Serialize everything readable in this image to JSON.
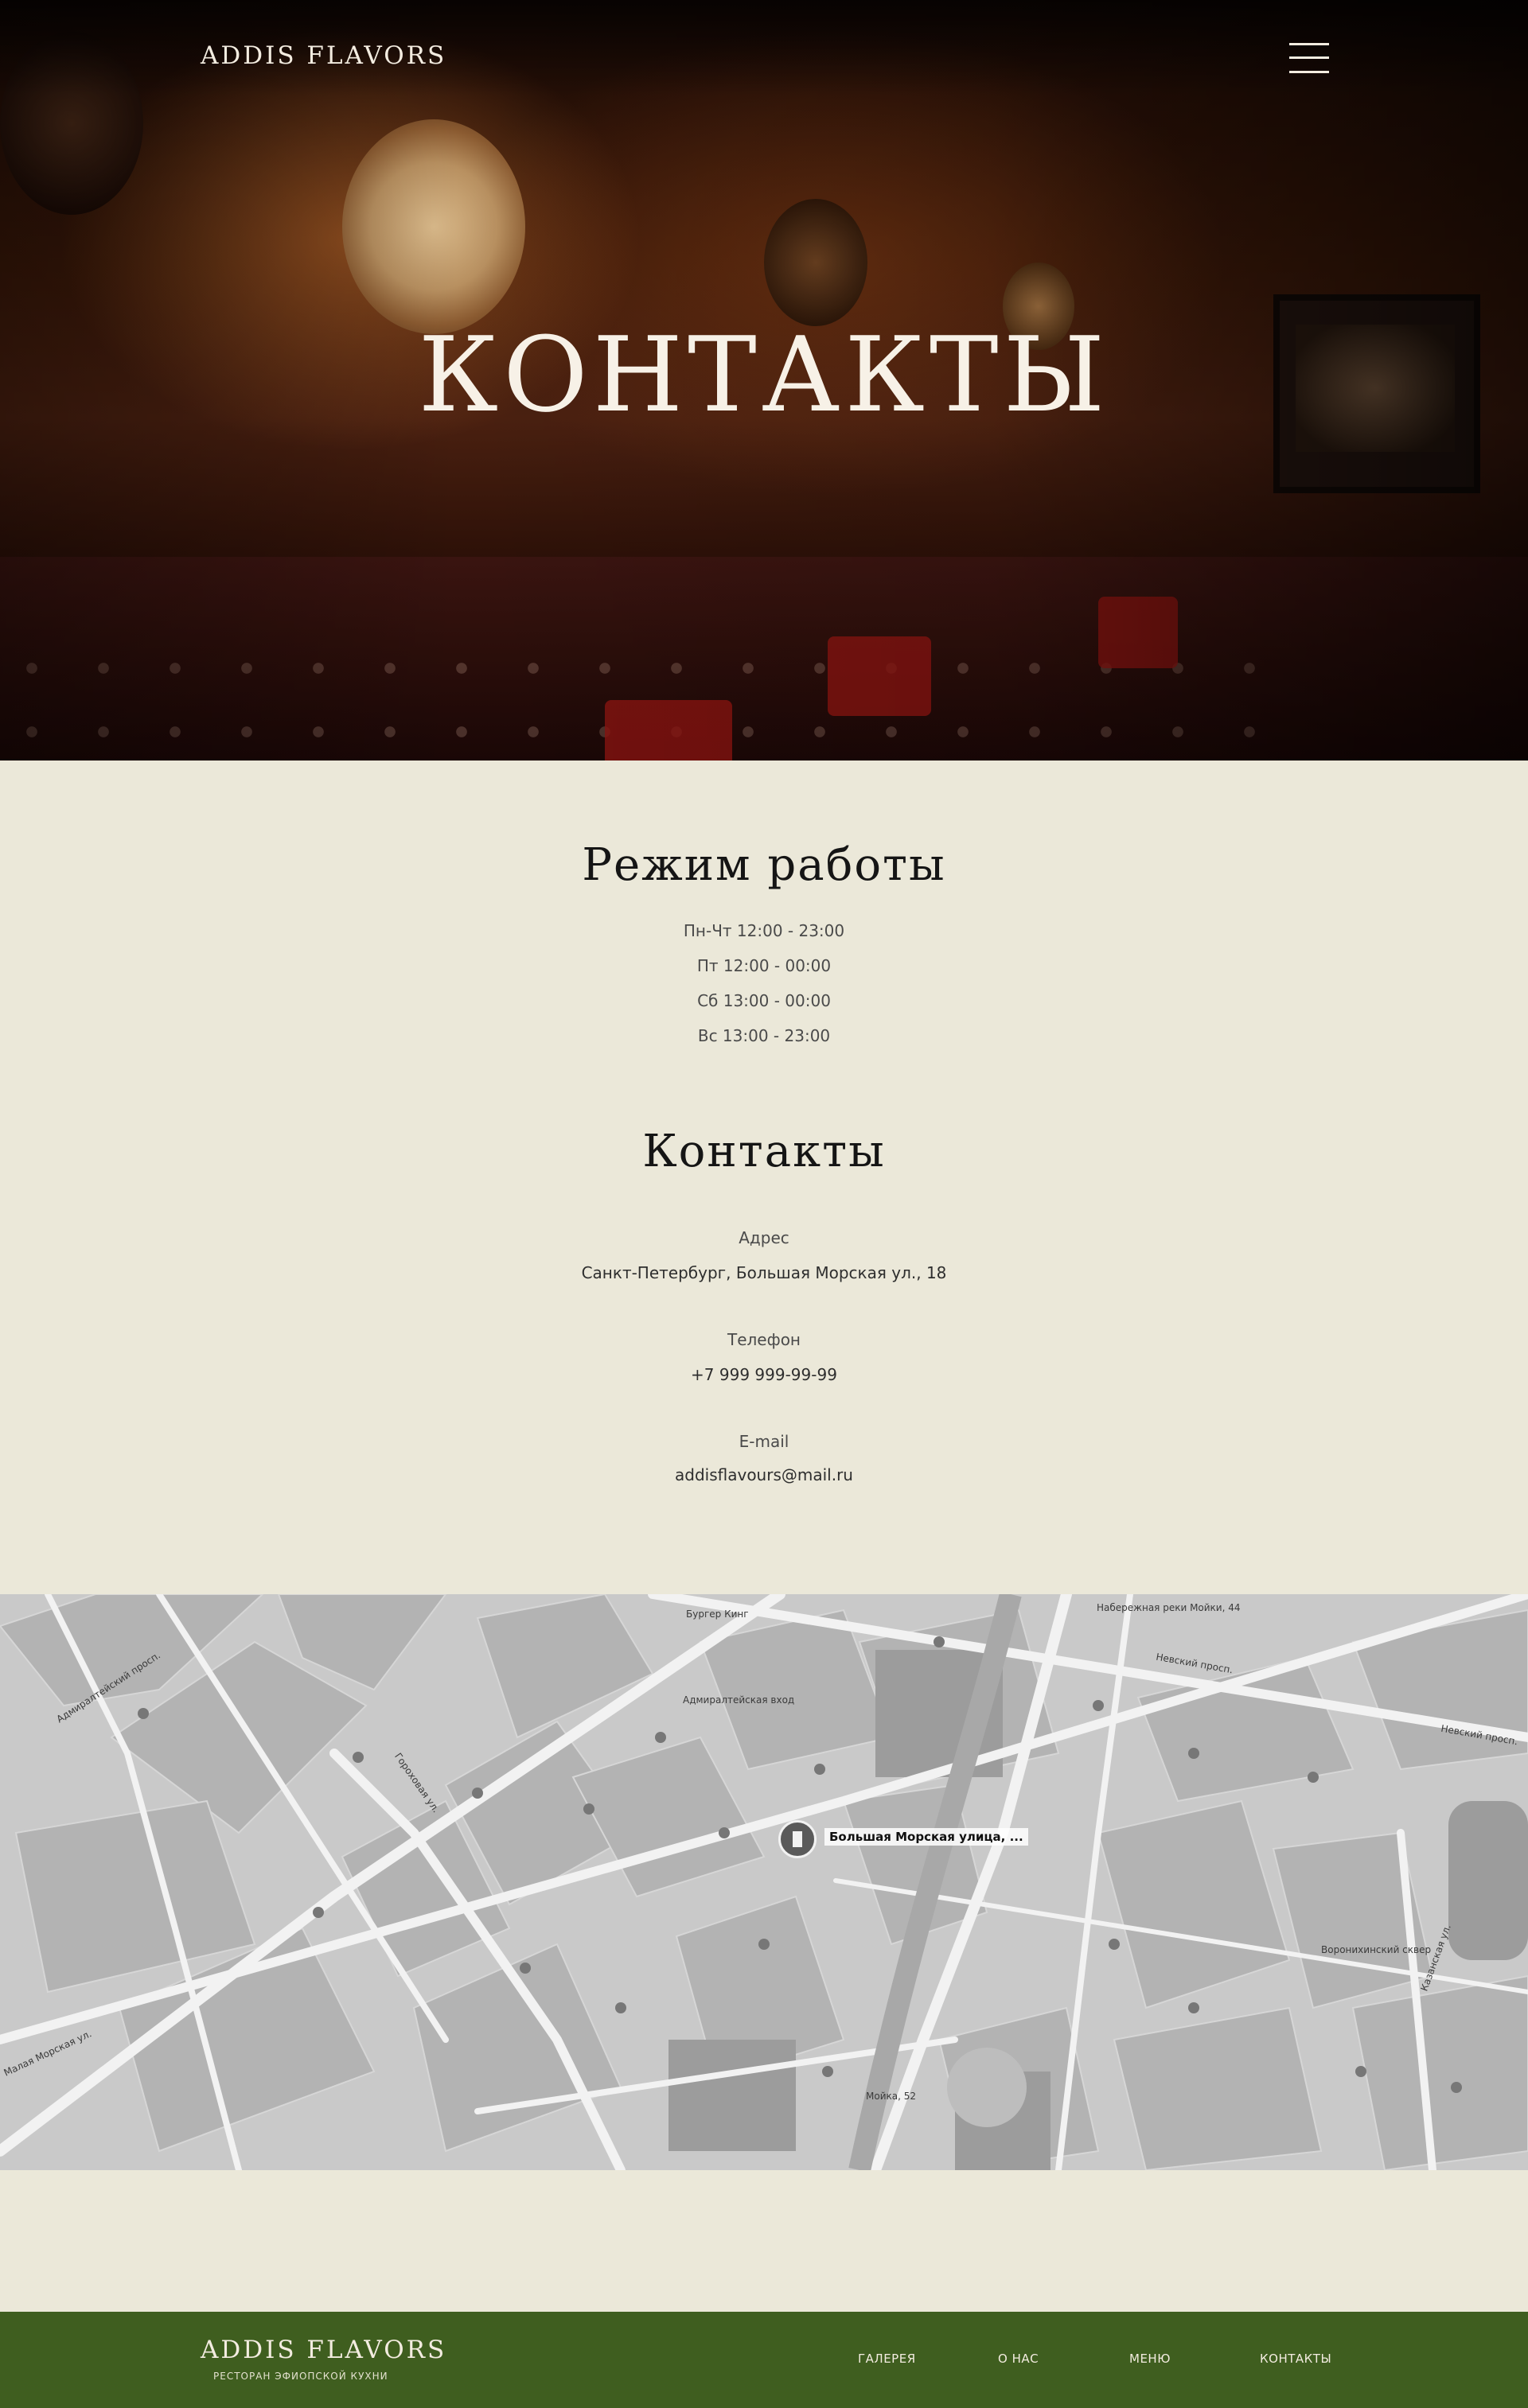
{
  "header": {
    "logo": "ADDIS FLAVORS",
    "menu_icon": "hamburger-menu-icon",
    "hero_title": "КОНТАКТЫ"
  },
  "schedule": {
    "title": "Режим работы",
    "lines": [
      "Пн-Чт 12:00 - 23:00",
      "Пт 12:00 - 00:00",
      "Сб 13:00 - 00:00",
      "Вс 13:00 - 23:00"
    ]
  },
  "contacts": {
    "title": "Контакты",
    "address_label": "Адрес",
    "address_value": "Санкт-Петербург, Большая Морская ул., 18",
    "phone_label": "Телефон",
    "phone_value": "+7 999 999-99-99",
    "email_label": "E-mail",
    "email_value": "addisflavours@mail.ru"
  },
  "map": {
    "pin_label": "Большая Морская улица, ...",
    "labels": [
      "Невский просп.",
      "Невский просп.",
      "Гороховая ул.",
      "Адмиралтейский просп.",
      "Малая Морская ул.",
      "Мойка, 52",
      "Казанская ул.",
      "Воронихинский сквер",
      "Адмиралтейская вход",
      "Бургер Кинг",
      "Набережная реки Мойки, 44"
    ]
  },
  "footer": {
    "logo": "ADDIS FLAVORS",
    "subtitle": "РЕСТОРАН ЭФИОПСКОЙ КУХНИ",
    "nav": [
      "ГАЛЕРЕЯ",
      "О НАС",
      "МЕНЮ",
      "КОНТАКТЫ"
    ]
  },
  "colors": {
    "background": "#ebe8d9",
    "footer": "#3f5e1f",
    "hero_text": "#f7f1e7"
  }
}
